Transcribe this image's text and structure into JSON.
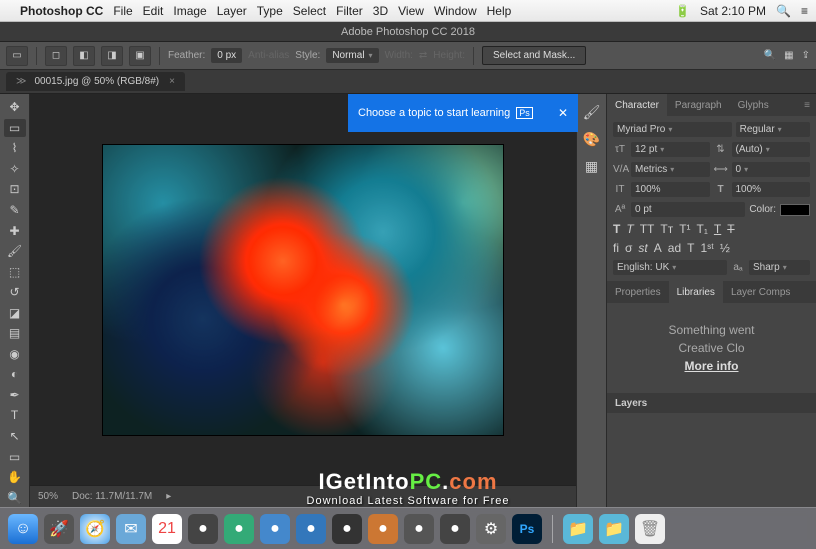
{
  "menubar": {
    "app_name": "Photoshop CC",
    "items": [
      "File",
      "Edit",
      "Image",
      "Layer",
      "Type",
      "Select",
      "Filter",
      "3D",
      "View",
      "Window",
      "Help"
    ],
    "clock": "Sat 2:10 PM"
  },
  "window": {
    "title": "Adobe Photoshop CC 2018"
  },
  "options": {
    "feather_label": "Feather:",
    "feather_value": "0 px",
    "anti_alias": "Anti-alias",
    "style_label": "Style:",
    "style_value": "Normal",
    "width_label": "Width:",
    "height_label": "Height:",
    "select_mask": "Select and Mask..."
  },
  "doc_tab": {
    "name": "00015.jpg @ 50% (RGB/8#)"
  },
  "learn_banner": {
    "text": "Choose a topic to start learning"
  },
  "status": {
    "zoom": "50%",
    "doc": "Doc: 11.7M/11.7M"
  },
  "char_panel": {
    "tabs": [
      "Character",
      "Paragraph",
      "Glyphs"
    ],
    "font": "Myriad Pro",
    "weight": "Regular",
    "size": "12 pt",
    "leading": "(Auto)",
    "kerning": "Metrics",
    "tracking": "0",
    "vscale": "100%",
    "hscale": "100%",
    "baseline": "0 pt",
    "color_label": "Color:",
    "lang": "English: UK",
    "aa": "Sharp"
  },
  "lib_panel": {
    "tabs": [
      "Properties",
      "Libraries",
      "Layer Comps"
    ],
    "msg1": "Something went",
    "msg2": "Creative Clo",
    "link": "More info"
  },
  "layers_panel": {
    "title": "Layers"
  },
  "watermark": {
    "brand_i": "I",
    "brand_get": "GetInto",
    "brand_pc": "PC",
    "brand_dot": ".",
    "brand_com": "com",
    "tagline": "Download Latest Software for Free"
  }
}
